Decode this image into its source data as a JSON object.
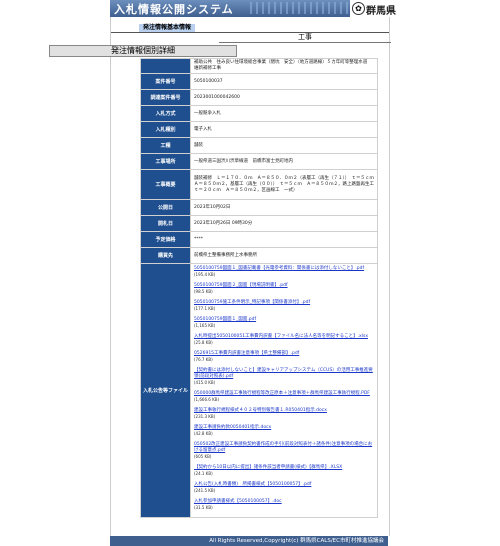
{
  "header": {
    "title": "入札情報公開システム",
    "prefecture": "群馬県",
    "seal_icon": "prefecture-seal-icon"
  },
  "tag": "発注情報基本情報",
  "kind": "工事",
  "detail_heading": "発注情報個別詳細",
  "rows": [
    {
      "label": "",
      "value": "補助公共　住み良い住環境総合事業（閉坑　安全）（地方道路線）５カ年町等整理水道　維新補修工事"
    },
    {
      "label": "案件番号",
      "value": "5050100037"
    },
    {
      "label": "調達案件番号",
      "value": "2023001000042600"
    },
    {
      "label": "入札方式",
      "value": "一般競争入札"
    },
    {
      "label": "入札種別",
      "value": "電子入札"
    },
    {
      "label": "工種",
      "value": "舗装"
    },
    {
      "label": "工事場所",
      "value": "一般県道三国渋川渋草線道　前橋市富士見町地内"
    },
    {
      "label": "工事概要",
      "value": "舗装補修　Ｌ＝１７０．０ｍ　Ａ＝８５０．０ｍ２（表層工（再生（７１））　ｔ＝５ｃｍ　Ａ＝８５０ｍ２，基層工（再生（００））　ｔ＝５ｃｍ　Ａ＝８５０ｍ２，路上路盤再生工　ｔ＝２０ｃｍ　Ａ＝８５０ｍ２，区画線工　一式）"
    },
    {
      "label": "公開日",
      "value": "2023年10月02日"
    },
    {
      "label": "開札日",
      "value": "2023年10月26日 09時30分"
    },
    {
      "label": "予定価格",
      "value": "****"
    },
    {
      "label": "購買先",
      "value": "前橋県土整備事務所上水事務所"
    }
  ],
  "files": {
    "label": "入札公告等ファイル",
    "items": [
      {
        "name": "5050100759図面１_図書記載書【光電参考資料：関係書には添付しないこと】.pdf",
        "size": "(195.4 KB)"
      },
      {
        "name": "5050100759図面２_図面【現場説明書】.pdf",
        "size": "(98.5 KB)"
      },
      {
        "name": "5050100759施工条件明示_特記事項【関係書添付】.pdf",
        "size": "(177.1 KB)"
      },
      {
        "name": "5050100759図面１_図面.pdf",
        "size": "(1,165 KB)"
      },
      {
        "name": "入札時提出5050100051工事費内訳書【ファイル名に法人名等を明記すること】.xlsx",
        "size": "(25.8 KB)"
      },
      {
        "name": "0526915工事費内訳書注意事項【県土整備部】.pdf",
        "size": "(76.7 KB)"
      },
      {
        "name": "【契約書には添付しないこと】建設キャリアアップシステム（CCUS）の活用工事推進要領(前段対照表).pdf",
        "size": "(415.0 KB)"
      },
      {
        "name": "050000群馬県建設工事執行規程等改正原本＋注意事項＋群馬県建設工事執行規程.PDF",
        "size": "(1,666.6 KB)"
      },
      {
        "name": "建設工事執行規程様式４０２号特別報告書１.R050401指示.docx",
        "size": "(231.3 KB)"
      },
      {
        "name": "建設工事請負約款0050401指示.docx",
        "size": "(42.8 KB)"
      },
      {
        "name": "050502改正建設工事請負契約書作成の手引(前段対照表付＋諸条件)注意事項の場合における留意点.pdf",
        "size": "(605 KB)"
      },
      {
        "name": "【契約から10日以内に提出】諸条件該当者申請書(様式)【群馬県】.XLSX",
        "size": "(24.1 KB)"
      },
      {
        "name": "入札公告(入札時書類)　所掲書様式【5050100057】.pdf",
        "size": "(241.5 KB)"
      },
      {
        "name": "入札参加申請書様式【5050100057】.doc",
        "size": "(31.5 KB)"
      }
    ]
  },
  "footer": "All Rights Reserved,Copyright(c) 群馬県CALS/EC市町村推進協議会"
}
